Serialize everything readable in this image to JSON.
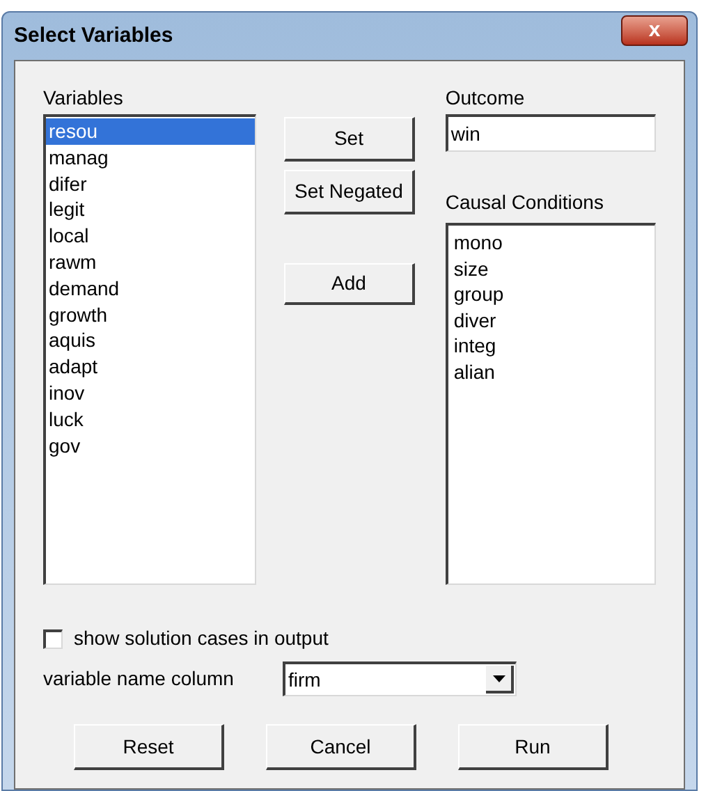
{
  "window": {
    "title": "Select Variables",
    "close": "x"
  },
  "variables": {
    "label": "Variables",
    "items": [
      {
        "name": "resou",
        "selected": true
      },
      {
        "name": "manag",
        "selected": false
      },
      {
        "name": "difer",
        "selected": false
      },
      {
        "name": "legit",
        "selected": false
      },
      {
        "name": "local",
        "selected": false
      },
      {
        "name": "rawm",
        "selected": false
      },
      {
        "name": "demand",
        "selected": false
      },
      {
        "name": "growth",
        "selected": false
      },
      {
        "name": "aquis",
        "selected": false
      },
      {
        "name": "adapt",
        "selected": false
      },
      {
        "name": "inov",
        "selected": false
      },
      {
        "name": "luck",
        "selected": false
      },
      {
        "name": "gov",
        "selected": false
      }
    ]
  },
  "middle_buttons": [
    "Set",
    "Set Negated"
  ],
  "add_button": "Add",
  "outcome": {
    "label": "Outcome",
    "value": "win"
  },
  "causal_conditions": {
    "label": "Causal Conditions",
    "items": [
      "mono",
      "size",
      "group",
      "diver",
      "integ",
      "alian"
    ]
  },
  "show_cases": {
    "label": "show solution cases in output",
    "checked": false
  },
  "name_column": {
    "label": "variable name column",
    "value": "firm"
  },
  "footer_buttons": [
    "Reset",
    "Cancel",
    "Run"
  ]
}
